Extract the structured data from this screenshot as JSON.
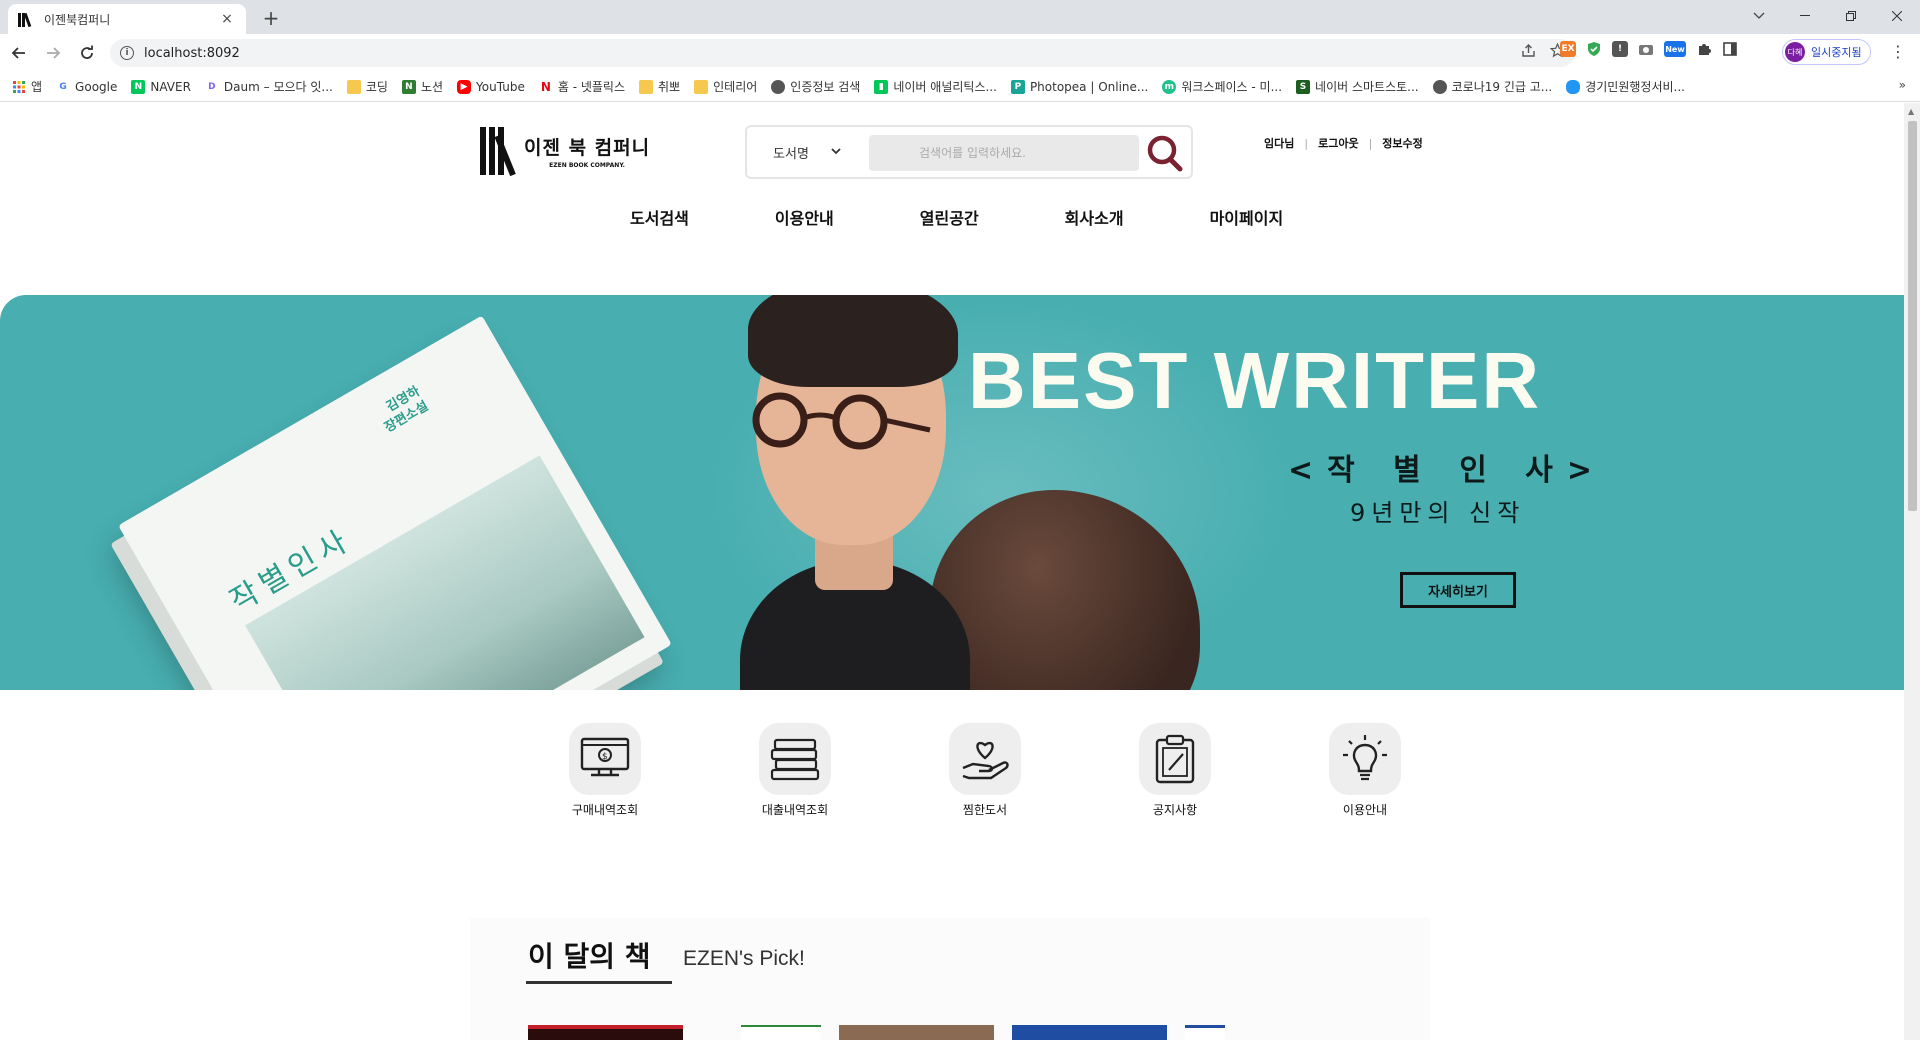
{
  "browser": {
    "tab_title": "이젠북컴퍼니",
    "tab_close": "×",
    "new_tab": "+",
    "url": "localhost:8092",
    "profile_avatar": "다혜",
    "profile_label": "일시중지됨",
    "ext_new_badge": "New",
    "bookmarks": [
      {
        "label": "앱",
        "icon": "apps-grid-icon",
        "color": "#e8453c"
      },
      {
        "label": "Google",
        "icon": "google-icon",
        "color": "#4285f4"
      },
      {
        "label": "NAVER",
        "icon": "naver-icon",
        "color": "#03c75a"
      },
      {
        "label": "Daum – 모으다 잇...",
        "icon": "daum-icon",
        "color": "#7b61ff"
      },
      {
        "label": "코딩",
        "icon": "folder-icon",
        "color": "#f6c94e"
      },
      {
        "label": "노션",
        "icon": "notion-icon",
        "color": "#2e7d32"
      },
      {
        "label": "YouTube",
        "icon": "youtube-icon",
        "color": "#ff0000"
      },
      {
        "label": "홈 - 넷플릭스",
        "icon": "netflix-icon",
        "color": "#e50914"
      },
      {
        "label": "취뽀",
        "icon": "folder-icon",
        "color": "#f6c94e"
      },
      {
        "label": "인테리어",
        "icon": "folder-icon",
        "color": "#f6c94e"
      },
      {
        "label": "인증정보 검색",
        "icon": "globe-icon",
        "color": "#555555"
      },
      {
        "label": "네이버 애널리틱스...",
        "icon": "analytics-icon",
        "color": "#03c75a"
      },
      {
        "label": "Photopea | Online...",
        "icon": "photopea-icon",
        "color": "#18a497"
      },
      {
        "label": "워크스페이스 - 미...",
        "icon": "workspace-icon",
        "color": "#1ec28b"
      },
      {
        "label": "네이버 스마트스토...",
        "icon": "smartstore-icon",
        "color": "#1b5e20"
      },
      {
        "label": "코로나19 긴급 고...",
        "icon": "globe-icon",
        "color": "#555555"
      },
      {
        "label": "경기민원행정서비...",
        "icon": "cloud-icon",
        "color": "#2196f3"
      }
    ],
    "bookmarks_more": "»"
  },
  "site": {
    "logo_name": "이젠 북 컴퍼니",
    "logo_sub": "EZEN BOOK COMPANY.",
    "search": {
      "category": "도서명",
      "placeholder": "검색어를 입력하세요."
    },
    "user_links": {
      "user": "임다님",
      "sep": "|",
      "logout": "로그아웃",
      "edit": "정보수정"
    },
    "gnb": [
      "도서검색",
      "이용안내",
      "열린공간",
      "회사소개",
      "마이페이지"
    ],
    "banner": {
      "title": "BEST WRITER",
      "subtitle": "<작 별 인 사>",
      "desc": "9년만의 신작",
      "button": "자세히보기",
      "book_title": "작별인사",
      "book_author": "김영하\n장편소설",
      "bg_color": "#48aeb0"
    },
    "quick_menu": [
      {
        "label": "구매내역조회",
        "icon": "purchase-monitor-icon"
      },
      {
        "label": "대출내역조회",
        "icon": "book-stack-icon"
      },
      {
        "label": "찜한도서",
        "icon": "heart-hand-icon"
      },
      {
        "label": "공지사항",
        "icon": "clipboard-icon"
      },
      {
        "label": "이용안내",
        "icon": "lightbulb-icon"
      }
    ],
    "month": {
      "title": "이 달의 책",
      "sub": "EZEN's Pick!"
    }
  }
}
